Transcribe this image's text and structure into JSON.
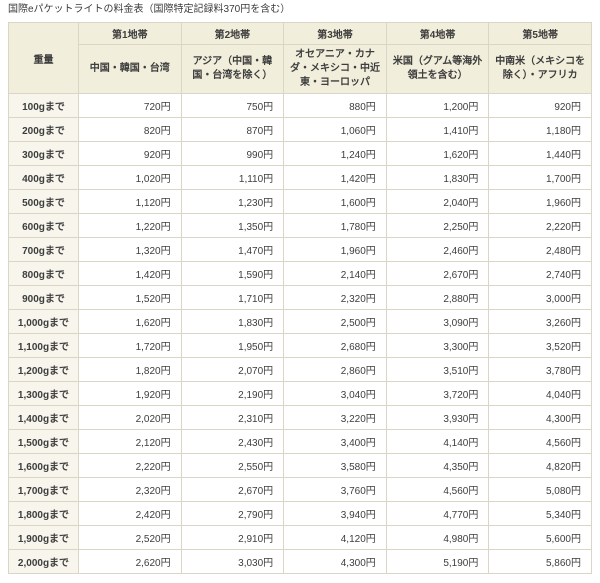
{
  "page": {
    "title": "国際eパケットライトの料金表（国際特定記録料370円を含む）"
  },
  "colors": {
    "header_bg": "#f1eedb",
    "weight_col_bg": "#f7f5ec",
    "border": "#d9d6c7",
    "text": "#3d3d3d"
  },
  "table": {
    "weight_header": "重量",
    "zones": [
      {
        "name": "第1地帯",
        "region": "中国・韓国・台湾"
      },
      {
        "name": "第2地帯",
        "region": "アジア（中国・韓国・台湾を除く）"
      },
      {
        "name": "第3地帯",
        "region": "オセアニア・カナダ・メキシコ・中近東・ヨーロッパ"
      },
      {
        "name": "第4地帯",
        "region": "米国（グアム等海外領土を含む）"
      },
      {
        "name": "第5地帯",
        "region": "中南米（メキシコを除く）・アフリカ"
      }
    ],
    "rows": [
      {
        "weight": "100gまで",
        "prices": [
          "720円",
          "750円",
          "880円",
          "1,200円",
          "920円"
        ]
      },
      {
        "weight": "200gまで",
        "prices": [
          "820円",
          "870円",
          "1,060円",
          "1,410円",
          "1,180円"
        ]
      },
      {
        "weight": "300gまで",
        "prices": [
          "920円",
          "990円",
          "1,240円",
          "1,620円",
          "1,440円"
        ]
      },
      {
        "weight": "400gまで",
        "prices": [
          "1,020円",
          "1,110円",
          "1,420円",
          "1,830円",
          "1,700円"
        ]
      },
      {
        "weight": "500gまで",
        "prices": [
          "1,120円",
          "1,230円",
          "1,600円",
          "2,040円",
          "1,960円"
        ]
      },
      {
        "weight": "600gまで",
        "prices": [
          "1,220円",
          "1,350円",
          "1,780円",
          "2,250円",
          "2,220円"
        ]
      },
      {
        "weight": "700gまで",
        "prices": [
          "1,320円",
          "1,470円",
          "1,960円",
          "2,460円",
          "2,480円"
        ]
      },
      {
        "weight": "800gまで",
        "prices": [
          "1,420円",
          "1,590円",
          "2,140円",
          "2,670円",
          "2,740円"
        ]
      },
      {
        "weight": "900gまで",
        "prices": [
          "1,520円",
          "1,710円",
          "2,320円",
          "2,880円",
          "3,000円"
        ]
      },
      {
        "weight": "1,000gまで",
        "prices": [
          "1,620円",
          "1,830円",
          "2,500円",
          "3,090円",
          "3,260円"
        ]
      },
      {
        "weight": "1,100gまで",
        "prices": [
          "1,720円",
          "1,950円",
          "2,680円",
          "3,300円",
          "3,520円"
        ]
      },
      {
        "weight": "1,200gまで",
        "prices": [
          "1,820円",
          "2,070円",
          "2,860円",
          "3,510円",
          "3,780円"
        ]
      },
      {
        "weight": "1,300gまで",
        "prices": [
          "1,920円",
          "2,190円",
          "3,040円",
          "3,720円",
          "4,040円"
        ]
      },
      {
        "weight": "1,400gまで",
        "prices": [
          "2,020円",
          "2,310円",
          "3,220円",
          "3,930円",
          "4,300円"
        ]
      },
      {
        "weight": "1,500gまで",
        "prices": [
          "2,120円",
          "2,430円",
          "3,400円",
          "4,140円",
          "4,560円"
        ]
      },
      {
        "weight": "1,600gまで",
        "prices": [
          "2,220円",
          "2,550円",
          "3,580円",
          "4,350円",
          "4,820円"
        ]
      },
      {
        "weight": "1,700gまで",
        "prices": [
          "2,320円",
          "2,670円",
          "3,760円",
          "4,560円",
          "5,080円"
        ]
      },
      {
        "weight": "1,800gまで",
        "prices": [
          "2,420円",
          "2,790円",
          "3,940円",
          "4,770円",
          "5,340円"
        ]
      },
      {
        "weight": "1,900gまで",
        "prices": [
          "2,520円",
          "2,910円",
          "4,120円",
          "4,980円",
          "5,600円"
        ]
      },
      {
        "weight": "2,000gまで",
        "prices": [
          "2,620円",
          "3,030円",
          "4,300円",
          "5,190円",
          "5,860円"
        ]
      }
    ]
  }
}
